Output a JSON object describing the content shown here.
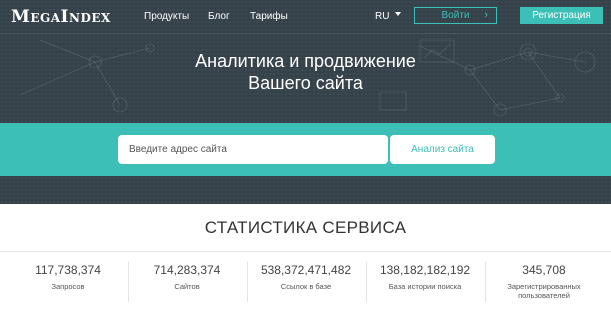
{
  "header": {
    "logo": "MegaIndex",
    "nav": [
      {
        "label": "Продукты"
      },
      {
        "label": "Блог"
      },
      {
        "label": "Тарифы"
      }
    ],
    "language": "RU",
    "login_label": "Войти",
    "register_label": "Регистрация"
  },
  "hero": {
    "title_line1": "Аналитика и продвижение",
    "title_line2": "Вашего сайта"
  },
  "search": {
    "placeholder": "Введите адрес сайта",
    "value": "",
    "button_label": "Анализ сайта"
  },
  "stats": {
    "title": "СТАТИСТИКА СЕРВИСА",
    "items": [
      {
        "value": "117,738,374",
        "label": "Запросов"
      },
      {
        "value": "714,283,374",
        "label": "Сайтов"
      },
      {
        "value": "538,372,471,482",
        "label": "Ссылок в базе"
      },
      {
        "value": "138,182,182,192",
        "label": "База истории поиска"
      },
      {
        "value": "345,708",
        "label": "Зарегистрированных пользователей"
      }
    ]
  },
  "colors": {
    "accent": "#3bbfb7",
    "header_bg": "#36424a"
  }
}
